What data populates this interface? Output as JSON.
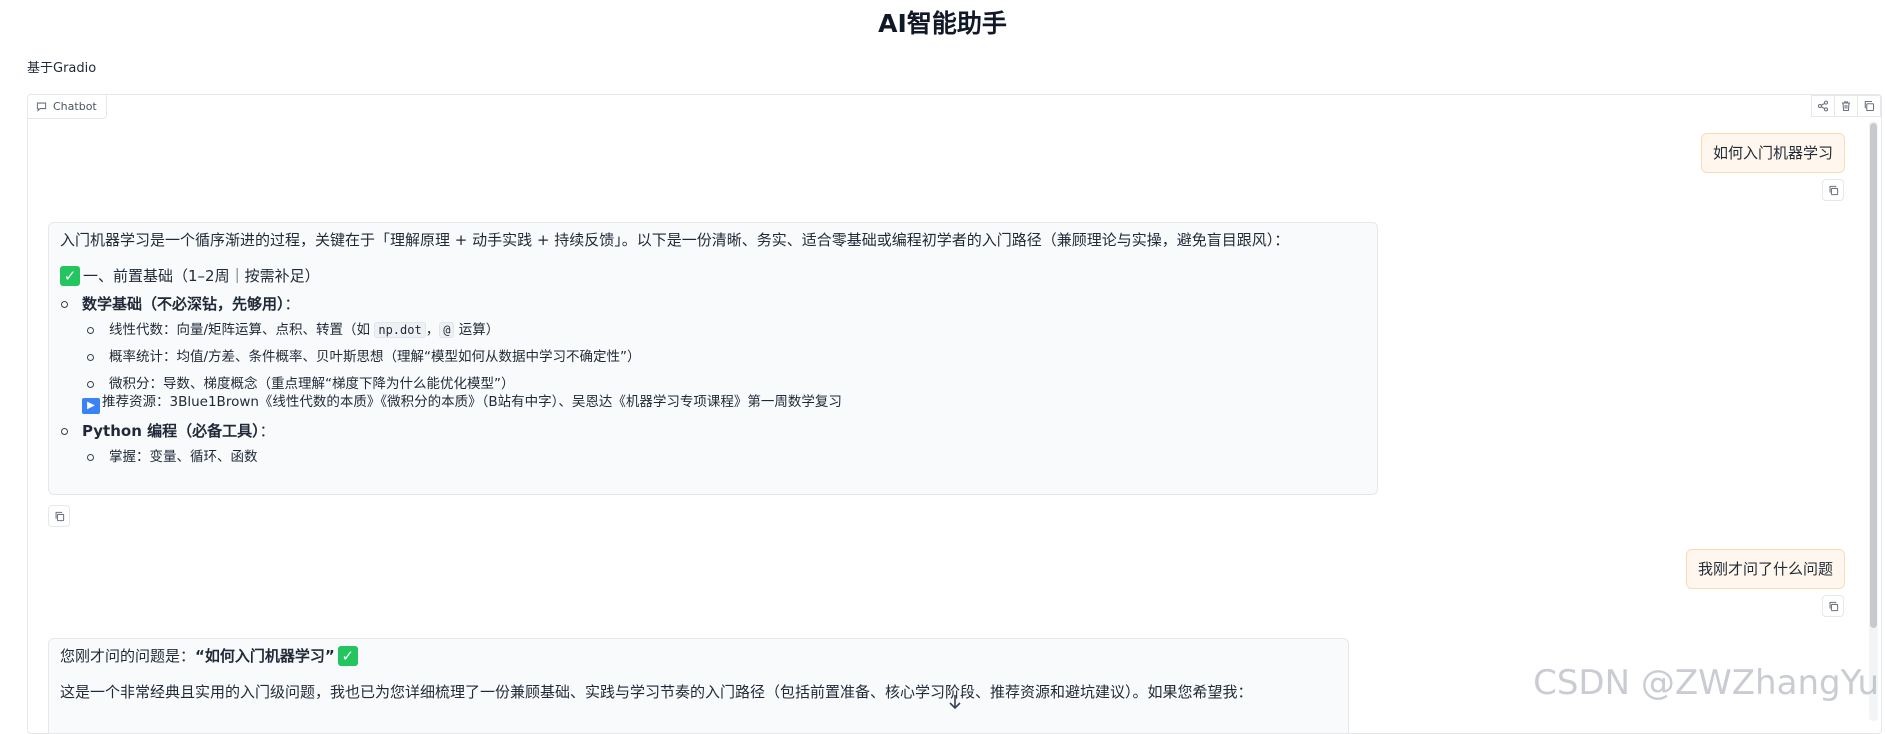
{
  "app": {
    "title": "AI智能助手",
    "subtitle": "基于Gradio"
  },
  "chatbot": {
    "label": "Chatbot",
    "icons": [
      "chat-icon",
      "share-icon",
      "trash-icon",
      "copy-icon"
    ]
  },
  "messages": {
    "user1": "如何入门机器学习",
    "bot1": {
      "intro": "入门机器学习是一个循序渐进的过程，关键在于「理解原理 + 动手实践 + 持续反馈」。以下是一份清晰、务实、适合零基础或编程初学者的入门路径（兼顾理论与实操，避免盲目跟风）：",
      "section1_title": "一、前置基础（1–2周｜按需补足）",
      "math_title": "数学基础（不必深钻，先够用）",
      "math_colon": "：",
      "linalg_before": "线性代数：向量/矩阵运算、点积、转置（如 ",
      "linalg_code1": "np.dot",
      "linalg_sep": "，",
      "linalg_code2": "@",
      "linalg_after": " 运算）",
      "prob": "概率统计：均值/方差、条件概率、贝叶斯思想（理解“模型如何从数据中学习不确定性”）",
      "calc": "微积分：导数、梯度概念（重点理解“梯度下降为什么能优化模型”）",
      "resource": "推荐资源：3Blue1Brown《线性代数的本质》《微积分的本质》（B站有中字）、吴恩达《机器学习专项课程》第一周数学复习",
      "python_title": "Python 编程（必备工具）",
      "python_colon": "：",
      "python_item": "掌握：变量、循环、函数"
    },
    "user2": "我刚才问了什么问题",
    "bot2": {
      "line1_prefix": "您刚才问的问题是：",
      "line1_bold": "“如何入门机器学习”",
      "line2": "这是一个非常经典且实用的入门级问题，我也已为您详细梳理了一份兼顾基础、实践与学习节奏的入门路径（包括前置准备、核心学习阶段、推荐资源和避坑建议）。如果您希望我："
    }
  },
  "watermark": "CSDN @ZWZhangYu",
  "colors": {
    "user_bubble_bg": "#fff7ed",
    "user_bubble_border": "#fcd9b6",
    "bot_bubble_bg": "#f9fafb",
    "check_green": "#22c55e",
    "play_blue": "#3b82f6"
  }
}
